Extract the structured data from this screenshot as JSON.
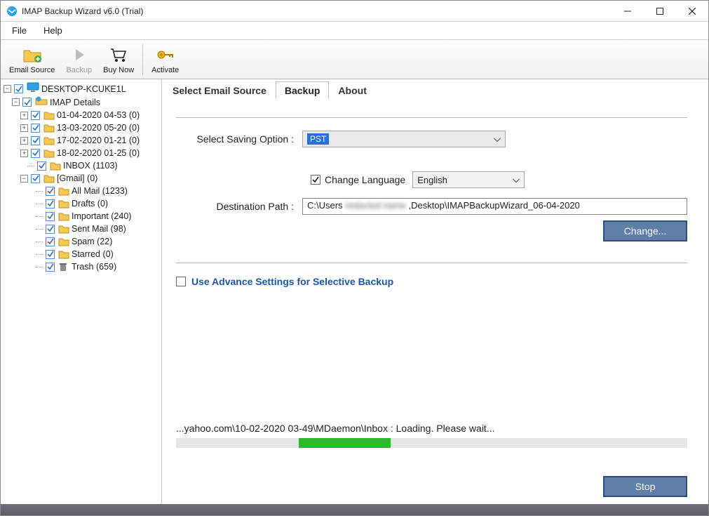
{
  "window": {
    "title": "IMAP Backup Wizard v6.0 (Trial)"
  },
  "menubar": {
    "file": "File",
    "help": "Help"
  },
  "toolbar": {
    "email_source": "Email Source",
    "backup": "Backup",
    "buy_now": "Buy Now",
    "activate": "Activate"
  },
  "tree": {
    "root": "DESKTOP-KCUKE1L",
    "imap_details": "IMAP Details",
    "dated_folders": [
      "01-04-2020 04-53 (0)",
      "13-03-2020 05-20 (0)",
      "17-02-2020 01-21 (0)",
      "18-02-2020 01-25 (0)"
    ],
    "inbox": "INBOX (1103)",
    "gmail": "[Gmail] (0)",
    "gmail_children": [
      "All Mail (1233)",
      "Drafts (0)",
      "Important (240)",
      "Sent Mail (98)",
      "Spam (22)",
      "Starred (0)",
      "Trash (659)"
    ]
  },
  "tabs": {
    "select_email_source": "Select Email Source",
    "backup": "Backup",
    "about": "About"
  },
  "form": {
    "saving_option_label": "Select Saving Option :",
    "saving_option_value": "PST",
    "change_language_label": "Change Language",
    "language_value": "English",
    "destination_label": "Destination Path :",
    "destination_value_prefix": "C:\\Users",
    "destination_value_blur": "redacted name",
    "destination_value_suffix": ",Desktop\\IMAPBackupWizard_06-04-2020",
    "change_button": "Change...",
    "advance_settings": "Use Advance Settings for Selective Backup"
  },
  "progress": {
    "status": "...yahoo.com\\10-02-2020 03-49\\MDaemon\\Inbox : Loading. Please wait...",
    "bar_left_pct": 24,
    "bar_width_pct": 18,
    "stop": "Stop"
  }
}
